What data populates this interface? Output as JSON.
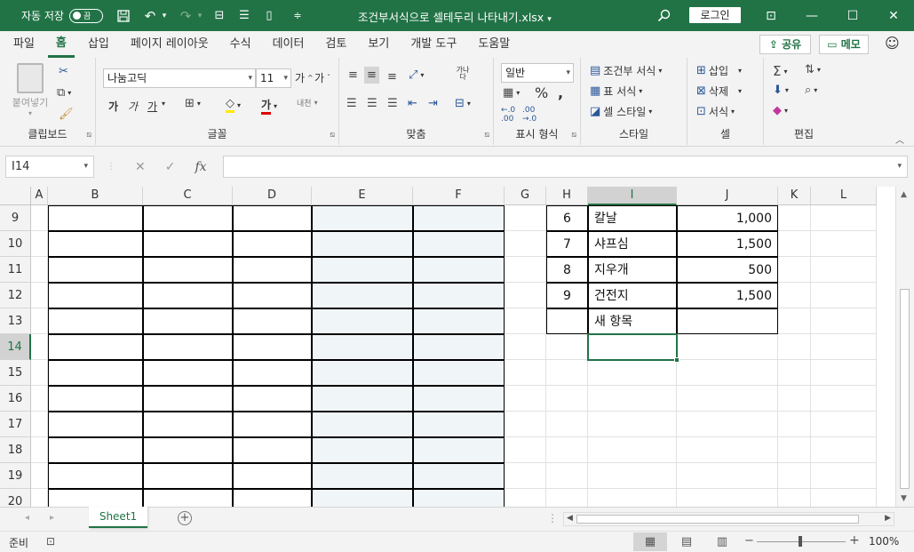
{
  "titlebar": {
    "autosave_label": "자동 저장",
    "autosave_state": "끔",
    "document_title": "조건부서식으로 셀테두리 나타내기.xlsx",
    "login_label": "로그인",
    "save_icon": "save-icon",
    "undo_icon": "undo-icon",
    "redo_icon": "redo-icon"
  },
  "ribbon_tabs": [
    "파일",
    "홈",
    "삽입",
    "페이지 레이아웃",
    "수식",
    "데이터",
    "검토",
    "보기",
    "개발 도구",
    "도움말"
  ],
  "active_tab": "홈",
  "share_label": "공유",
  "memo_label": "메모",
  "ribbon": {
    "clipboard": {
      "label": "클립보드",
      "paste": "붙여넣기"
    },
    "font": {
      "label": "글꼴",
      "font_name": "나눔고딕",
      "font_size": "11",
      "bold": "가",
      "italic": "가",
      "underline": "가",
      "grow": "가",
      "shrink": "가",
      "font_color_letter": "가",
      "phonetic": "내천"
    },
    "alignment": {
      "label": "맞춤",
      "wrap": "가나다"
    },
    "number": {
      "label": "표시 형식",
      "format": "일반"
    },
    "styles": {
      "label": "스타일",
      "conditional": "조건부 서식",
      "table": "표 서식",
      "cell_style": "셀 스타일"
    },
    "cells": {
      "label": "셀",
      "insert": "삽입",
      "delete": "삭제",
      "format": "서식"
    },
    "editing": {
      "label": "편집"
    }
  },
  "formula_bar": {
    "name_box": "I14",
    "fx": "fx",
    "formula": ""
  },
  "columns": [
    "A",
    "B",
    "C",
    "D",
    "E",
    "F",
    "G",
    "H",
    "I",
    "J",
    "K",
    "L"
  ],
  "selected_column": "I",
  "rows": [
    "9",
    "10",
    "11",
    "12",
    "13",
    "14",
    "15",
    "16",
    "17",
    "18",
    "19",
    "20"
  ],
  "selected_row": "14",
  "table_rows": [
    {
      "no": "6",
      "item": "칼날",
      "price": "1,000"
    },
    {
      "no": "7",
      "item": "샤프심",
      "price": "1,500"
    },
    {
      "no": "8",
      "item": "지우개",
      "price": "500"
    },
    {
      "no": "9",
      "item": "건전지",
      "price": "1,500"
    },
    {
      "no": "",
      "item": "새 항목",
      "price": ""
    }
  ],
  "sheet_tab": "Sheet1",
  "status": {
    "ready": "준비",
    "zoom": "100%"
  },
  "colors": {
    "accent": "#217346",
    "tint": "#f0f6f8"
  }
}
